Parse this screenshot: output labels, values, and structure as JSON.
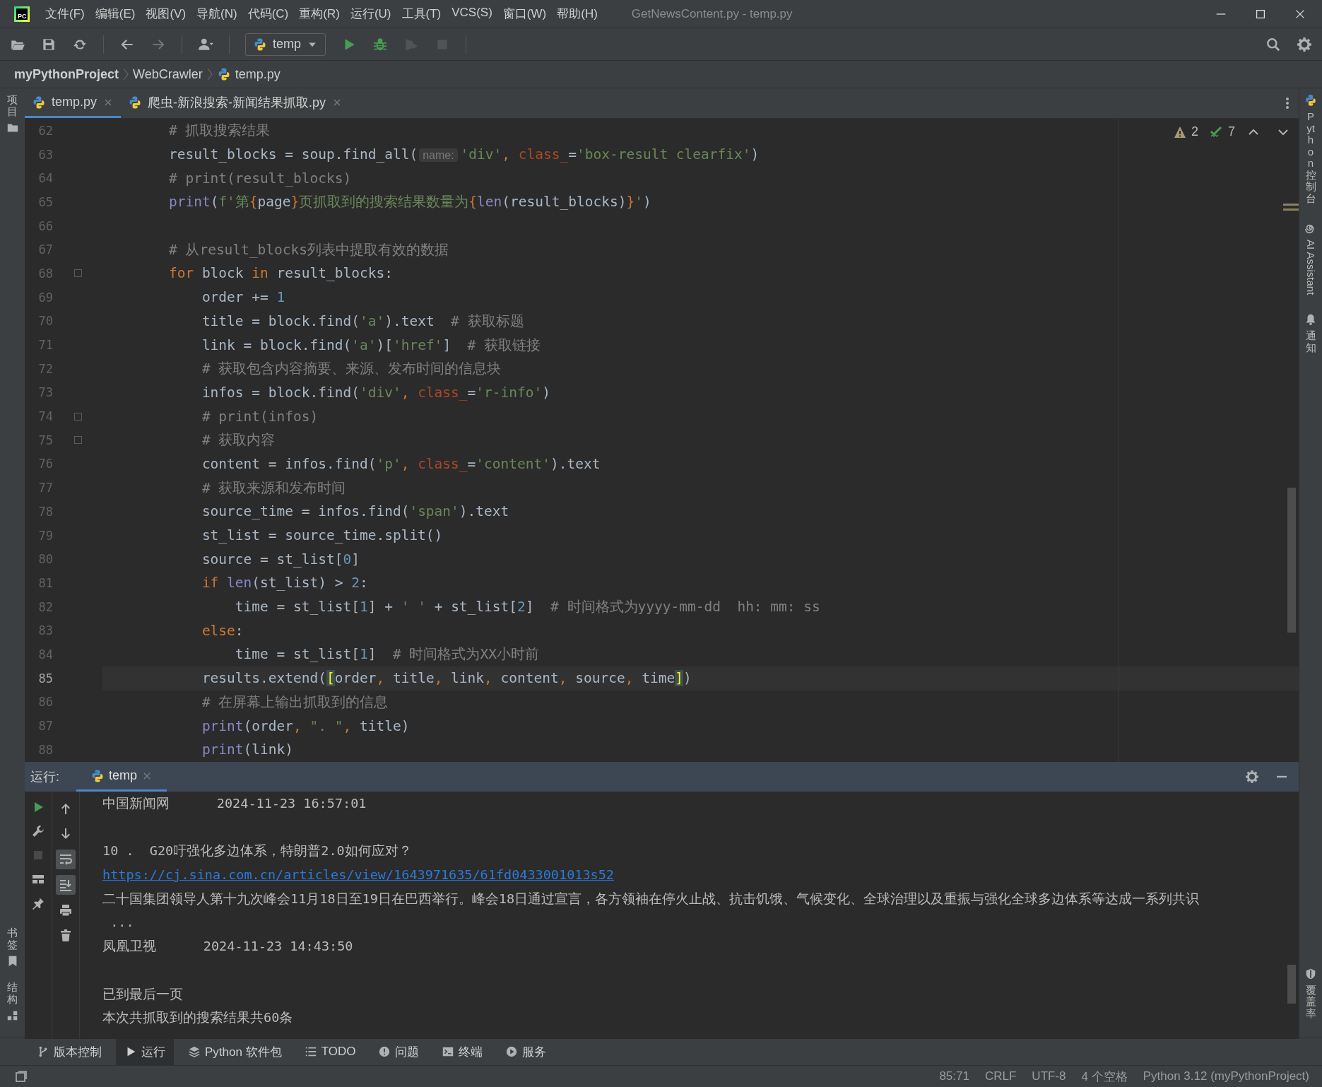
{
  "window": {
    "logo_text": "PC",
    "title": "GetNewsContent.py - temp.py"
  },
  "menu": [
    "文件(F)",
    "编辑(E)",
    "视图(V)",
    "导航(N)",
    "代码(C)",
    "重构(R)",
    "运行(U)",
    "工具(T)",
    "VCS(S)",
    "窗口(W)",
    "帮助(H)"
  ],
  "toolbar_buttons": [
    {
      "kind": "open",
      "disabled": false
    },
    {
      "kind": "save",
      "disabled": false
    },
    {
      "kind": "sync",
      "disabled": false
    },
    {
      "kind": "back",
      "disabled": false
    },
    {
      "kind": "forward",
      "disabled": true
    },
    {
      "kind": "user",
      "disabled": false
    }
  ],
  "run_config": "temp",
  "run_buttons": [
    {
      "kind": "run",
      "disabled": false
    },
    {
      "kind": "debug",
      "disabled": false
    },
    {
      "kind": "coverage",
      "disabled": true
    },
    {
      "kind": "stop",
      "disabled": true
    }
  ],
  "breadcrumb": [
    {
      "kind": "project",
      "text": "myPythonProject"
    },
    {
      "kind": "folder",
      "text": "WebCrawler"
    },
    {
      "kind": "file",
      "text": "temp.py"
    }
  ],
  "editor_tabs": [
    {
      "label": "temp.py",
      "selected": true
    },
    {
      "label": "爬虫-新浪搜索-新闻结果抓取.py",
      "selected": false
    }
  ],
  "left_strip": {
    "top": [
      "项目"
    ],
    "bottom": [
      "书签",
      "结构"
    ]
  },
  "right_strip": {
    "top": [
      "Python 控制台",
      "AI Assistant",
      "通知"
    ],
    "bottom": [
      "覆盖率"
    ]
  },
  "inspections": {
    "warnings": "2",
    "weak_warnings": "7"
  },
  "code_lines": [
    {
      "number": "62",
      "current": false,
      "fold": false,
      "tokens": [
        {
          "kind": "comment",
          "text": "        # 抓取搜索结果"
        }
      ]
    },
    {
      "number": "63",
      "current": false,
      "fold": false,
      "tokens": [
        {
          "kind": "plain",
          "text": "        result_blocks = soup.find_all("
        },
        {
          "kind": "hint",
          "text": "name:"
        },
        {
          "kind": "string",
          "text": "'div'"
        },
        {
          "kind": "keyword",
          "text": ", "
        },
        {
          "kind": "param",
          "text": "class_"
        },
        {
          "kind": "plain",
          "text": "="
        },
        {
          "kind": "string",
          "text": "'box-result clearfix'"
        },
        {
          "kind": "plain",
          "text": ")"
        }
      ]
    },
    {
      "number": "64",
      "current": false,
      "fold": false,
      "tokens": [
        {
          "kind": "comment",
          "text": "        # print(result_blocks)"
        }
      ]
    },
    {
      "number": "65",
      "current": false,
      "fold": false,
      "tokens": [
        {
          "kind": "builtin",
          "text": "        print"
        },
        {
          "kind": "plain",
          "text": "("
        },
        {
          "kind": "string",
          "text": "f'第"
        },
        {
          "kind": "keyword",
          "text": "{"
        },
        {
          "kind": "plain",
          "text": "page"
        },
        {
          "kind": "keyword",
          "text": "}"
        },
        {
          "kind": "string",
          "text": "页抓取到的搜索结果数量为"
        },
        {
          "kind": "keyword",
          "text": "{"
        },
        {
          "kind": "builtin",
          "text": "len"
        },
        {
          "kind": "plain",
          "text": "(result_blocks)"
        },
        {
          "kind": "keyword",
          "text": "}"
        },
        {
          "kind": "string",
          "text": "'"
        },
        {
          "kind": "plain",
          "text": ")"
        }
      ]
    },
    {
      "number": "66",
      "current": false,
      "fold": false
    },
    {
      "number": "67",
      "current": false,
      "fold": false,
      "tokens": [
        {
          "kind": "comment",
          "text": "        # 从result_blocks列表中提取有效的数据"
        }
      ]
    },
    {
      "number": "68",
      "current": false,
      "fold": true,
      "tokens": [
        {
          "kind": "keyword",
          "text": "        for"
        },
        {
          "kind": "plain",
          "text": " block "
        },
        {
          "kind": "keyword",
          "text": "in"
        },
        {
          "kind": "plain",
          "text": " result_blocks:"
        }
      ]
    },
    {
      "number": "69",
      "current": false,
      "fold": false,
      "tokens": [
        {
          "kind": "plain",
          "text": "            order += "
        },
        {
          "kind": "number",
          "text": "1"
        }
      ]
    },
    {
      "number": "70",
      "current": false,
      "fold": false,
      "tokens": [
        {
          "kind": "plain",
          "text": "            title = block.find("
        },
        {
          "kind": "string",
          "text": "'a'"
        },
        {
          "kind": "plain",
          "text": ").text  "
        },
        {
          "kind": "comment",
          "text": "# 获取标题"
        }
      ]
    },
    {
      "number": "71",
      "current": false,
      "fold": false,
      "tokens": [
        {
          "kind": "plain",
          "text": "            link = block.find("
        },
        {
          "kind": "string",
          "text": "'a'"
        },
        {
          "kind": "plain",
          "text": ")["
        },
        {
          "kind": "string",
          "text": "'href'"
        },
        {
          "kind": "plain",
          "text": "]  "
        },
        {
          "kind": "comment",
          "text": "# 获取链接"
        }
      ]
    },
    {
      "number": "72",
      "current": false,
      "fold": false,
      "tokens": [
        {
          "kind": "comment",
          "text": "            # 获取包含内容摘要、来源、发布时间的信息块"
        }
      ]
    },
    {
      "number": "73",
      "current": false,
      "fold": false,
      "tokens": [
        {
          "kind": "plain",
          "text": "            infos = block.find("
        },
        {
          "kind": "string",
          "text": "'div'"
        },
        {
          "kind": "keyword",
          "text": ", "
        },
        {
          "kind": "param",
          "text": "class_"
        },
        {
          "kind": "plain",
          "text": "="
        },
        {
          "kind": "string",
          "text": "'r-info'"
        },
        {
          "kind": "plain",
          "text": ")"
        }
      ]
    },
    {
      "number": "74",
      "current": false,
      "fold": true,
      "tokens": [
        {
          "kind": "comment",
          "text": "            # print(infos)"
        }
      ]
    },
    {
      "number": "75",
      "current": false,
      "fold": true,
      "tokens": [
        {
          "kind": "comment",
          "text": "            # 获取内容"
        }
      ]
    },
    {
      "number": "76",
      "current": false,
      "fold": false,
      "tokens": [
        {
          "kind": "plain",
          "text": "            content = infos.find("
        },
        {
          "kind": "string",
          "text": "'p'"
        },
        {
          "kind": "keyword",
          "text": ", "
        },
        {
          "kind": "param",
          "text": "class_"
        },
        {
          "kind": "plain",
          "text": "="
        },
        {
          "kind": "string",
          "text": "'content'"
        },
        {
          "kind": "plain",
          "text": ").text"
        }
      ]
    },
    {
      "number": "77",
      "current": false,
      "fold": false,
      "tokens": [
        {
          "kind": "comment",
          "text": "            # 获取来源和发布时间"
        }
      ]
    },
    {
      "number": "78",
      "current": false,
      "fold": false,
      "tokens": [
        {
          "kind": "plain",
          "text": "            source_time = infos.find("
        },
        {
          "kind": "string",
          "text": "'span'"
        },
        {
          "kind": "plain",
          "text": ").text"
        }
      ]
    },
    {
      "number": "79",
      "current": false,
      "fold": false,
      "tokens": [
        {
          "kind": "plain",
          "text": "            st_list = source_time.split()"
        }
      ]
    },
    {
      "number": "80",
      "current": false,
      "fold": false,
      "tokens": [
        {
          "kind": "plain",
          "text": "            source = st_list["
        },
        {
          "kind": "number",
          "text": "0"
        },
        {
          "kind": "plain",
          "text": "]"
        }
      ]
    },
    {
      "number": "81",
      "current": false,
      "fold": false,
      "tokens": [
        {
          "kind": "keyword",
          "text": "            if "
        },
        {
          "kind": "builtin",
          "text": "len"
        },
        {
          "kind": "plain",
          "text": "(st_list) > "
        },
        {
          "kind": "number",
          "text": "2"
        },
        {
          "kind": "plain",
          "text": ":"
        }
      ]
    },
    {
      "number": "82",
      "current": false,
      "fold": false,
      "tokens": [
        {
          "kind": "plain",
          "text": "                time = st_list["
        },
        {
          "kind": "number",
          "text": "1"
        },
        {
          "kind": "plain",
          "text": "] + "
        },
        {
          "kind": "string",
          "text": "' '"
        },
        {
          "kind": "plain",
          "text": " + st_list["
        },
        {
          "kind": "number",
          "text": "2"
        },
        {
          "kind": "plain",
          "text": "]  "
        },
        {
          "kind": "comment",
          "text": "# 时间格式为yyyy-mm-dd  hh: mm: ss"
        }
      ]
    },
    {
      "number": "83",
      "current": false,
      "fold": false,
      "tokens": [
        {
          "kind": "keyword",
          "text": "            else"
        },
        {
          "kind": "plain",
          "text": ":"
        }
      ]
    },
    {
      "number": "84",
      "current": false,
      "fold": false,
      "tokens": [
        {
          "kind": "plain",
          "text": "                time = st_list["
        },
        {
          "kind": "number",
          "text": "1"
        },
        {
          "kind": "plain",
          "text": "]  "
        },
        {
          "kind": "comment",
          "text": "# 时间格式为XX小时前"
        }
      ]
    },
    {
      "number": "85",
      "current": true,
      "fold": false,
      "tokens": [
        {
          "kind": "plain",
          "text": "            results.extend("
        },
        {
          "kind": "match",
          "text": "["
        },
        {
          "kind": "plain",
          "text": "order"
        },
        {
          "kind": "keyword",
          "text": ", "
        },
        {
          "kind": "plain",
          "text": "title"
        },
        {
          "kind": "keyword",
          "text": ", "
        },
        {
          "kind": "plain",
          "text": "link"
        },
        {
          "kind": "keyword",
          "text": ", "
        },
        {
          "kind": "plain",
          "text": "content"
        },
        {
          "kind": "keyword",
          "text": ", "
        },
        {
          "kind": "plain",
          "text": "source"
        },
        {
          "kind": "keyword",
          "text": ", "
        },
        {
          "kind": "plain",
          "text": "time"
        },
        {
          "kind": "match",
          "text": "]"
        },
        {
          "kind": "plain",
          "text": ")"
        }
      ]
    },
    {
      "number": "86",
      "current": false,
      "fold": false,
      "tokens": [
        {
          "kind": "comment",
          "text": "            # 在屏幕上输出抓取到的信息"
        }
      ]
    },
    {
      "number": "87",
      "current": false,
      "fold": false,
      "tokens": [
        {
          "kind": "builtin",
          "text": "            print"
        },
        {
          "kind": "plain",
          "text": "(order"
        },
        {
          "kind": "keyword",
          "text": ", "
        },
        {
          "kind": "string",
          "text": "\". \""
        },
        {
          "kind": "keyword",
          "text": ", "
        },
        {
          "kind": "plain",
          "text": "title)"
        }
      ]
    },
    {
      "number": "88",
      "current": false,
      "fold": false,
      "tokens": [
        {
          "kind": "builtin",
          "text": "            print"
        },
        {
          "kind": "plain",
          "text": "(link)"
        }
      ]
    }
  ],
  "run_panel": {
    "label": "运行:",
    "tab": "temp",
    "left_buttons": [
      {
        "kind": "rerun",
        "disabled": false
      },
      {
        "kind": "wrench",
        "disabled": false
      },
      {
        "kind": "stop",
        "disabled": true
      },
      {
        "kind": "layout",
        "disabled": false
      },
      {
        "kind": "pin",
        "disabled": false
      }
    ],
    "right_buttons": [
      {
        "kind": "up",
        "on": false
      },
      {
        "kind": "down",
        "on": false
      },
      {
        "kind": "wrap",
        "on": true
      },
      {
        "kind": "scroll-end",
        "on": true
      },
      {
        "kind": "print",
        "on": false
      },
      {
        "kind": "trash",
        "on": false
      }
    ],
    "output": [
      {
        "kind": "text",
        "text": "中国新闻网      2024-11-23 16:57:01"
      },
      {
        "kind": "blank"
      },
      {
        "kind": "text",
        "text": "10 .  G20吁强化多边体系，特朗普2.0如何应对？"
      },
      {
        "kind": "link",
        "text": "https://cj.sina.com.cn/articles/view/1643971635/61fd0433001013s52"
      },
      {
        "kind": "text",
        "text": "二十国集团领导人第十九次峰会11月18日至19日在巴西举行。峰会18日通过宣言，各方领袖在停火止战、抗击饥饿、气候变化、全球治理以及重振与强化全球多边体系等达成一系列共识"
      },
      {
        "kind": "text",
        "text": " ..."
      },
      {
        "kind": "text",
        "text": "凤凰卫视      2024-11-23 14:43:50"
      },
      {
        "kind": "blank"
      },
      {
        "kind": "text",
        "text": "已到最后一页"
      },
      {
        "kind": "text",
        "text": "本次共抓取到的搜索结果共60条"
      }
    ]
  },
  "tool_tabs": [
    {
      "kind": "vcs",
      "label": "版本控制",
      "selected": false
    },
    {
      "kind": "run",
      "label": "运行",
      "selected": true
    },
    {
      "kind": "packages",
      "label": "Python 软件包",
      "selected": false
    },
    {
      "kind": "todo",
      "label": "TODO",
      "selected": false
    },
    {
      "kind": "problems",
      "label": "问题",
      "selected": false
    },
    {
      "kind": "terminal",
      "label": "终端",
      "selected": false
    },
    {
      "kind": "services",
      "label": "服务",
      "selected": false
    }
  ],
  "status_bar": [
    "85:71",
    "CRLF",
    "UTF-8",
    "4 个空格",
    "Python 3.12 (myPythonProject)"
  ]
}
